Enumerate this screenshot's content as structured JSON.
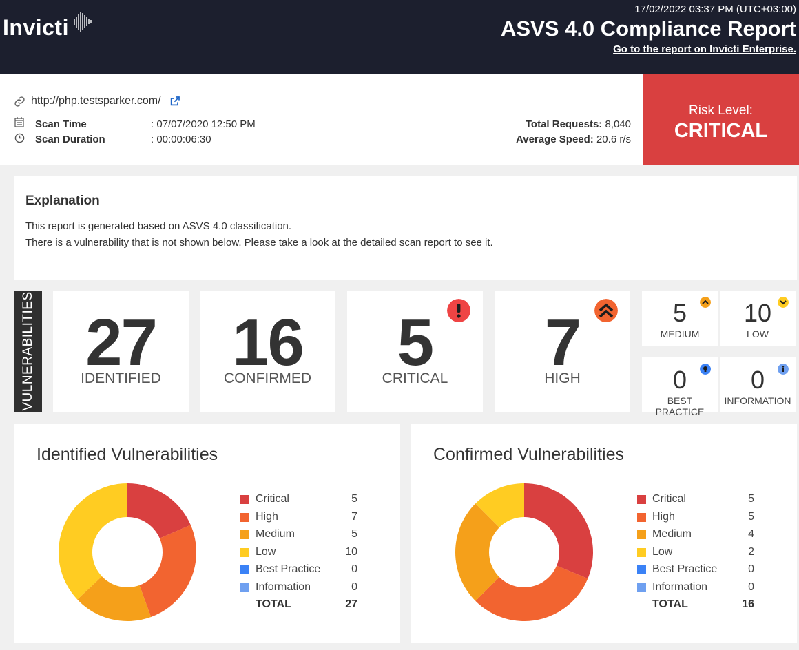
{
  "header": {
    "logo_text": "Invicti",
    "datetime": "17/02/2022 03:37 PM (UTC+03:00)",
    "title": "ASVS 4.0 Compliance Report",
    "link": "Go to the report on Invicti Enterprise."
  },
  "scan": {
    "url": "http://php.testsparker.com/",
    "scan_time_label": "Scan Time",
    "scan_time_value": ": 07/07/2020 12:50 PM",
    "scan_duration_label": "Scan Duration",
    "scan_duration_value": ": 00:00:06:30",
    "total_requests_label": "Total Requests:",
    "total_requests_value": "8,040",
    "avg_speed_label": "Average Speed:",
    "avg_speed_value": "20.6 r/s"
  },
  "risk": {
    "label": "Risk Level:",
    "value": "CRITICAL",
    "color": "#d94040"
  },
  "explanation": {
    "heading": "Explanation",
    "line1": "This report is generated based on ASVS 4.0 classification.",
    "line2": "There is a vulnerability that is not shown below. Please take a look at the detailed scan report to see it."
  },
  "vulnerabilities": {
    "tab_label": "VULNERABILITIES",
    "identified": {
      "value": "27",
      "label": "IDENTIFIED"
    },
    "confirmed": {
      "value": "16",
      "label": "CONFIRMED"
    },
    "critical": {
      "value": "5",
      "label": "CRITICAL",
      "icon": "exclamation-icon",
      "color": "#ef4444"
    },
    "high": {
      "value": "7",
      "label": "HIGH",
      "icon": "double-chevron-up-icon",
      "color": "#f26430"
    },
    "medium": {
      "value": "5",
      "label": "MEDIUM",
      "icon": "chevron-up-icon",
      "color": "#f5a01a"
    },
    "low": {
      "value": "10",
      "label": "LOW",
      "icon": "chevron-down-icon",
      "color": "#ffcc22"
    },
    "best_practice": {
      "value": "0",
      "label": "BEST PRACTICE",
      "icon": "lightbulb-icon",
      "color": "#3b82f6"
    },
    "information": {
      "value": "0",
      "label": "INFORMATION",
      "icon": "info-icon",
      "color": "#6fa0f0"
    }
  },
  "chart_data": [
    {
      "type": "pie",
      "title": "Identified Vulnerabilities",
      "categories": [
        "Critical",
        "High",
        "Medium",
        "Low",
        "Best Practice",
        "Information"
      ],
      "values": [
        5,
        7,
        5,
        10,
        0,
        0
      ],
      "colors": [
        "#d94040",
        "#f26430",
        "#f5a01a",
        "#ffcc22",
        "#3b82f6",
        "#6fa0f0"
      ],
      "total_label": "TOTAL",
      "total": 27
    },
    {
      "type": "pie",
      "title": "Confirmed Vulnerabilities",
      "categories": [
        "Critical",
        "High",
        "Medium",
        "Low",
        "Best Practice",
        "Information"
      ],
      "values": [
        5,
        5,
        4,
        2,
        0,
        0
      ],
      "colors": [
        "#d94040",
        "#f26430",
        "#f5a01a",
        "#ffcc22",
        "#3b82f6",
        "#6fa0f0"
      ],
      "total_label": "TOTAL",
      "total": 16
    }
  ]
}
